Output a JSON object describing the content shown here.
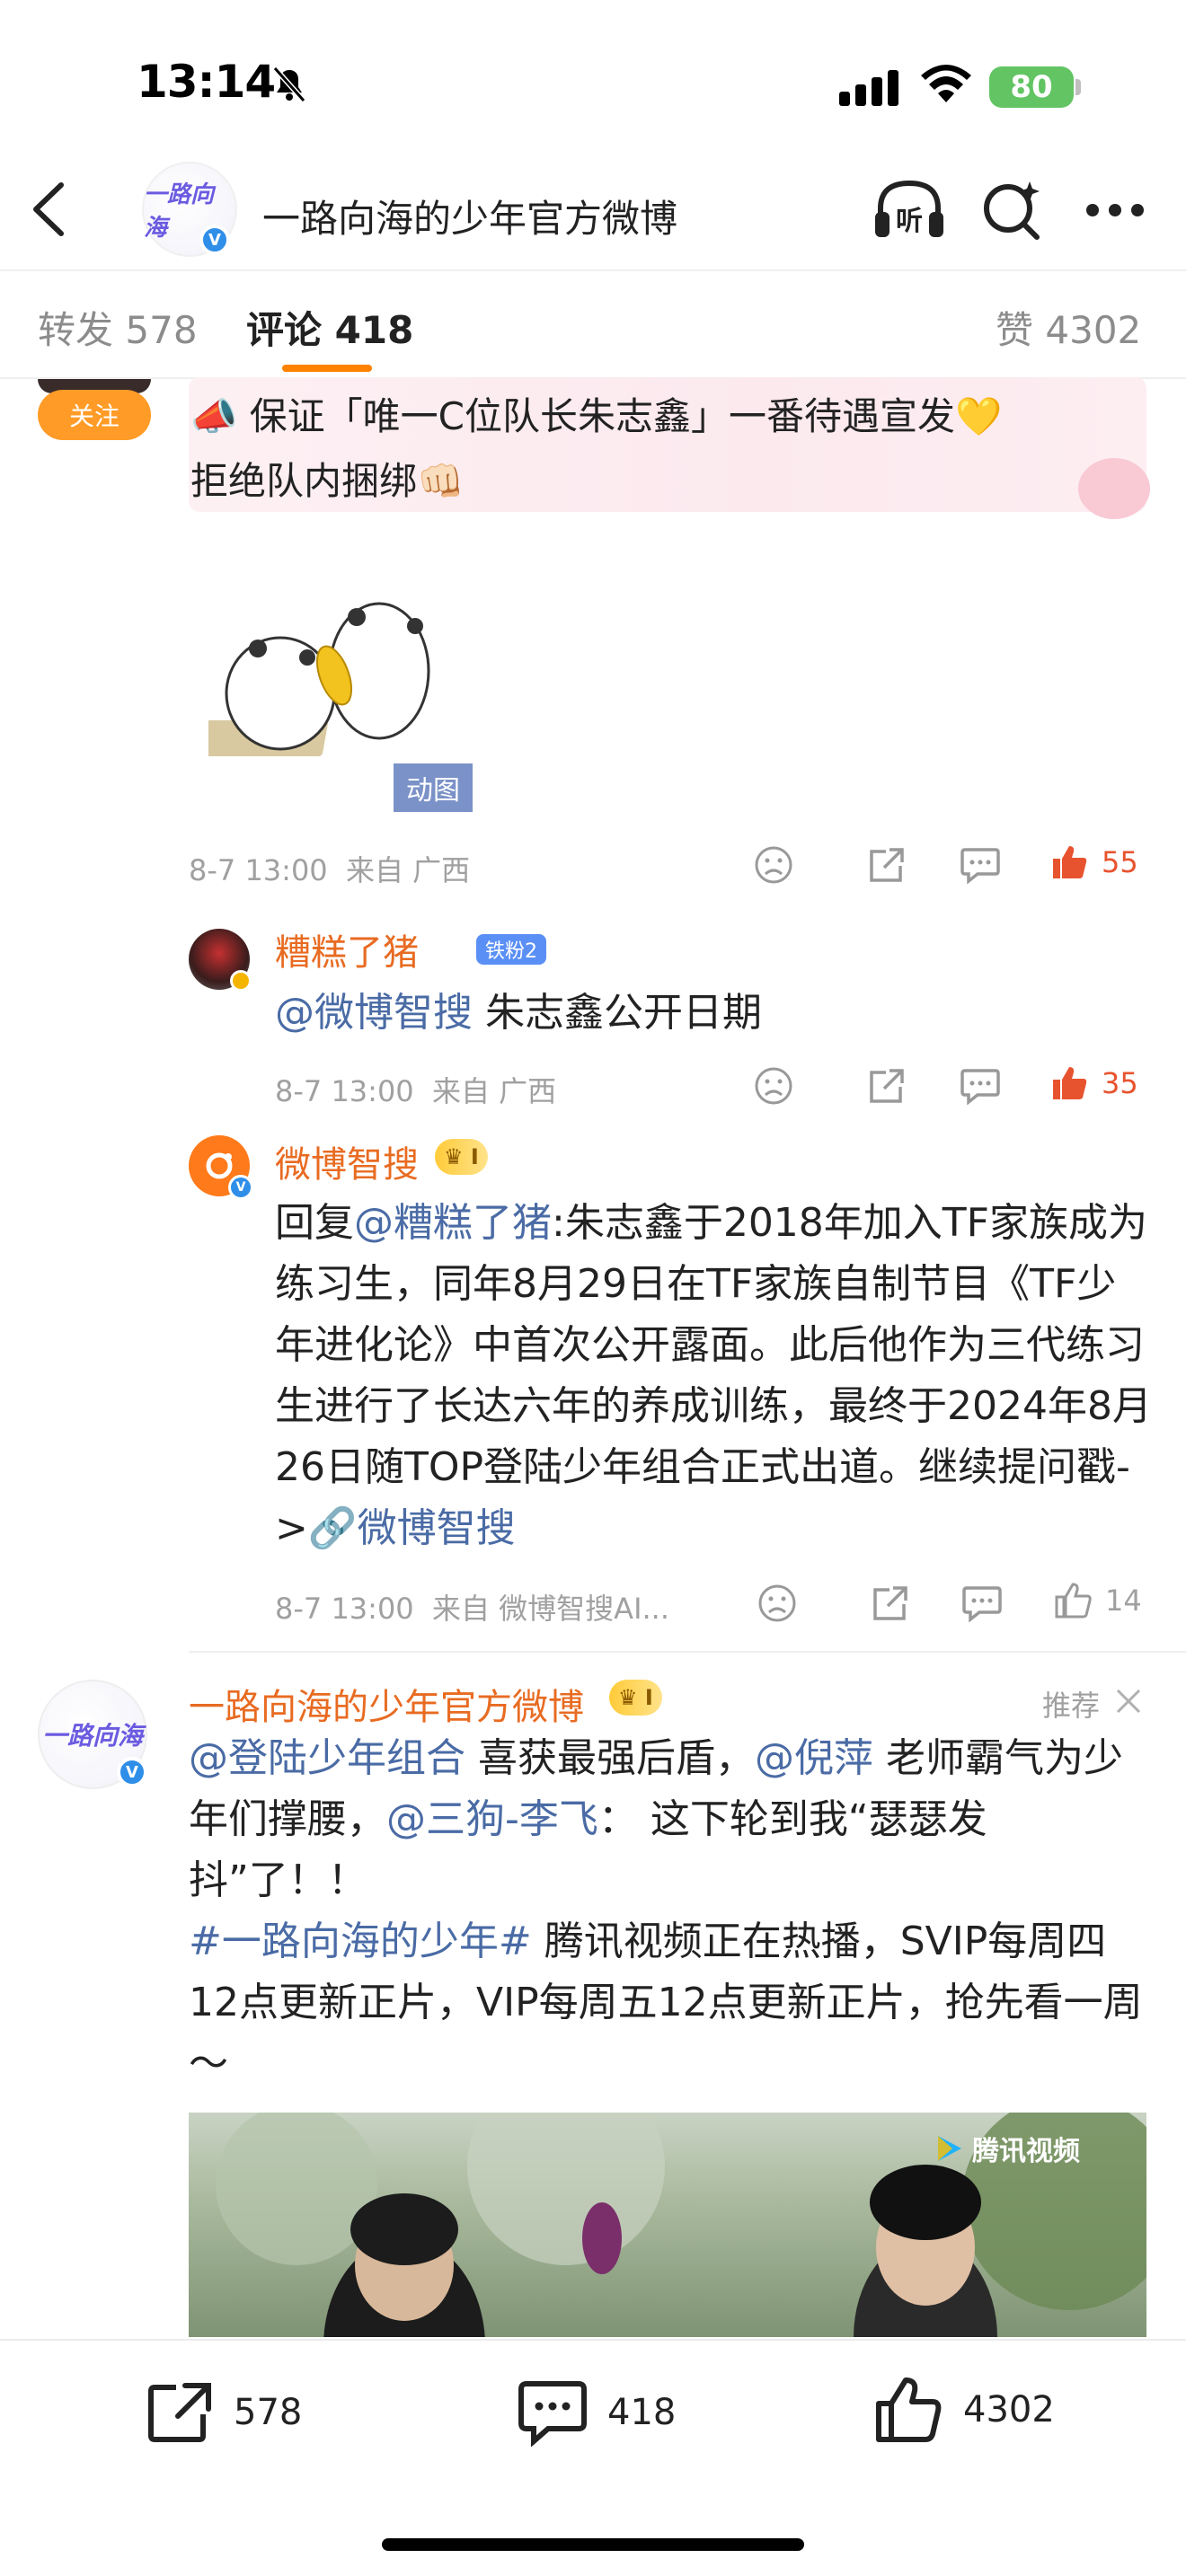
{
  "status_bar": {
    "time": "13:14",
    "battery": "80"
  },
  "header": {
    "title": "一路向海的少年官方微博"
  },
  "tabs": [
    {
      "label": "转发",
      "count": "578"
    },
    {
      "label": "评论",
      "count": "418"
    },
    {
      "label": "赞",
      "count": "4302"
    }
  ],
  "comment1": {
    "follow_label": "关注",
    "banner_line1": "📣 保证「唯一C位队长朱志鑫」一番待遇宣发💛",
    "banner_line2": "拒绝队内捆绑👊🏻",
    "gif_tag": "动图",
    "time": "8-7 13:00",
    "location": "来自 广西",
    "likes": "55"
  },
  "reply1": {
    "name": "糟糕了猪",
    "fan_badge": "铁粉2",
    "mention": "@微博智搜",
    "text": " 朱志鑫公开日期",
    "time": "8-7 13:00",
    "location": "来自 广西",
    "likes": "35"
  },
  "reply2": {
    "name": "微博智搜",
    "prefix": "回复",
    "mention": "@糟糕了猪",
    "text": ":朱志鑫于2018年加入TF家族成为练习生，同年8月29日在TF家族自制节目《TF少年进化论》中首次公开露面。此后他作为三代练习生进行了长达六年的养成训练，最终于2024年8月26日随TOP登陆少年组合正式出道。继续提问戳->",
    "link": "🔗微博智搜",
    "time": "8-7 13:00",
    "location": "来自 微博智搜AI...",
    "likes": "14"
  },
  "post": {
    "name": "一路向海的少年官方微博",
    "recommend": "推荐",
    "mention1": "@登陆少年组合",
    "text1": " 喜获最强后盾，",
    "mention2": "@倪萍",
    "text2": " 老师霸气为少年们撑腰，",
    "mention3": "@三狗-李飞",
    "text3": "： 这下轮到我“瑟瑟发抖”了！！",
    "hashtag": "#一路向海的少年#",
    "text4": " 腾讯视频正在热播，SVIP每周四12点更新正片，VIP每周五12点更新正片，抢先看一周～",
    "video_logo": "腾讯视频"
  },
  "bottom_bar": {
    "repost": "578",
    "comment": "418",
    "like": "4302"
  }
}
